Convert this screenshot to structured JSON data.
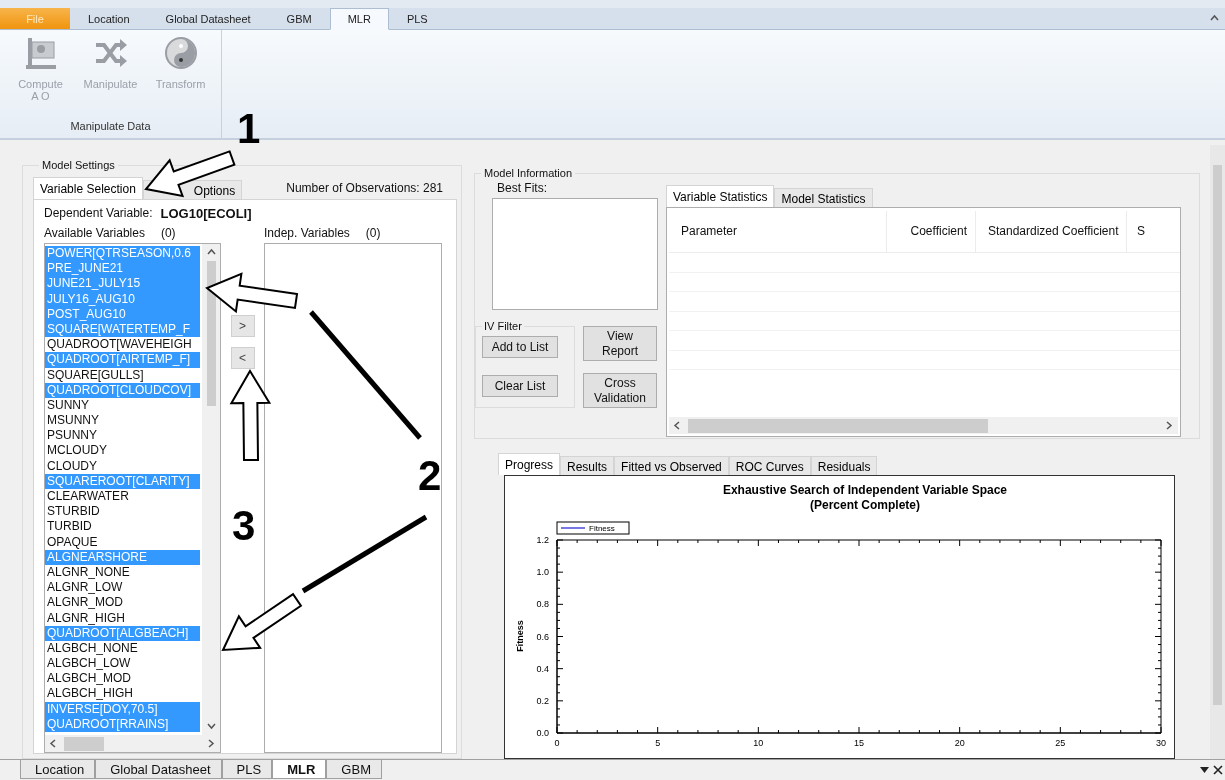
{
  "ribbon": {
    "file_tab": "File",
    "tabs": [
      {
        "label": "Location",
        "selected": false
      },
      {
        "label": "Global Datasheet",
        "selected": false
      },
      {
        "label": "GBM",
        "selected": false
      },
      {
        "label": "MLR",
        "selected": true
      },
      {
        "label": "PLS",
        "selected": false
      }
    ],
    "groups": [
      {
        "label": "Manipulate Data",
        "buttons": [
          {
            "label": "Compute\nA O",
            "kind": "flag",
            "disabled": true
          },
          {
            "label": "Manipulate",
            "kind": "shuffle",
            "disabled": true
          },
          {
            "label": "Transform",
            "kind": "yinyang",
            "disabled": true
          }
        ]
      }
    ]
  },
  "model_settings": {
    "title": "Model Settings",
    "tabs": [
      {
        "label": "Variable Selection",
        "selected": true
      },
      {
        "label": "Options",
        "selected": false
      }
    ],
    "observations": "Number of Observations: 281",
    "dependent_label": "Dependent Variable:",
    "dependent_value": "LOG10[ECOLI]",
    "available_label": "Available Variables",
    "available_count": "(0)",
    "indep_label": "Indep. Variables",
    "indep_count": "(0)",
    "move_buttons": [
      ">",
      "<"
    ],
    "available_variables": [
      {
        "name": "POWER[QTRSEASON,0.6",
        "selected": true
      },
      {
        "name": "PRE_JUNE21",
        "selected": true
      },
      {
        "name": "JUNE21_JULY15",
        "selected": true
      },
      {
        "name": "JULY16_AUG10",
        "selected": true
      },
      {
        "name": "POST_AUG10",
        "selected": true
      },
      {
        "name": "SQUARE[WATERTEMP_F",
        "selected": true
      },
      {
        "name": "QUADROOT[WAVEHEIGH",
        "selected": false
      },
      {
        "name": "QUADROOT[AIRTEMP_F]",
        "selected": true
      },
      {
        "name": "SQUARE[GULLS]",
        "selected": false
      },
      {
        "name": "QUADROOT[CLOUDCOV]",
        "selected": true
      },
      {
        "name": "SUNNY",
        "selected": false
      },
      {
        "name": "MSUNNY",
        "selected": false
      },
      {
        "name": "PSUNNY",
        "selected": false
      },
      {
        "name": "MCLOUDY",
        "selected": false
      },
      {
        "name": "CLOUDY",
        "selected": false
      },
      {
        "name": "SQUAREROOT[CLARITY]",
        "selected": true
      },
      {
        "name": "CLEARWATER",
        "selected": false
      },
      {
        "name": "STURBID",
        "selected": false
      },
      {
        "name": "TURBID",
        "selected": false
      },
      {
        "name": "OPAQUE",
        "selected": false
      },
      {
        "name": "ALGNEARSHORE",
        "selected": true
      },
      {
        "name": "ALGNR_NONE",
        "selected": false
      },
      {
        "name": "ALGNR_LOW",
        "selected": false
      },
      {
        "name": "ALGNR_MOD",
        "selected": false
      },
      {
        "name": "ALGNR_HIGH",
        "selected": false
      },
      {
        "name": "QUADROOT[ALGBEACH]",
        "selected": true
      },
      {
        "name": "ALGBCH_NONE",
        "selected": false
      },
      {
        "name": "ALGBCH_LOW",
        "selected": false
      },
      {
        "name": "ALGBCH_MOD",
        "selected": false
      },
      {
        "name": "ALGBCH_HIGH",
        "selected": false
      },
      {
        "name": "INVERSE[DOY,70.5]",
        "selected": true
      },
      {
        "name": "QUADROOT[RRAINS]",
        "selected": true
      }
    ]
  },
  "model_information": {
    "title": "Model Information",
    "best_fits_label": "Best Fits:",
    "iv_filter": {
      "title": "IV Filter",
      "buttons": [
        "Add to List",
        "Clear List"
      ]
    },
    "buttons": [
      "View\nReport",
      "Cross\nValidation"
    ],
    "stats_tabs": [
      {
        "label": "Variable Statistics",
        "selected": true
      },
      {
        "label": "Model Statistics",
        "selected": false
      }
    ],
    "table": {
      "columns": [
        "Parameter",
        "Coefficient",
        "Standardized Coefficient",
        "S"
      ]
    }
  },
  "result_tabs": [
    {
      "label": "Progress",
      "selected": true
    },
    {
      "label": "Results",
      "selected": false
    },
    {
      "label": "Fitted vs Observed",
      "selected": false
    },
    {
      "label": "ROC Curves",
      "selected": false
    },
    {
      "label": "Residuals",
      "selected": false
    }
  ],
  "progress_chart": {
    "chart_data": {
      "type": "line",
      "title": "Exhaustive Search of Independent Variable Space\n(Percent Complete)",
      "ylabel": "Fitness",
      "series": [
        {
          "name": "Fitness",
          "color": "#4a4adc",
          "values": [
            null,
            null,
            null,
            null,
            null,
            null,
            null
          ]
        }
      ],
      "categories": [
        "0",
        "5",
        "10",
        "15",
        "20",
        "25",
        "30"
      ],
      "ylim": [
        0,
        1.2
      ],
      "yticks": [
        {
          "value": 0,
          "label": "0.0"
        },
        {
          "value": 0.2,
          "label": "0.2"
        },
        {
          "value": 0.4,
          "label": "0.4"
        },
        {
          "value": 0.6,
          "label": "0.6"
        },
        {
          "value": 0.8,
          "label": "0.8"
        },
        {
          "value": 1,
          "label": "1.0"
        },
        {
          "value": 1.2,
          "label": "1.2"
        }
      ]
    }
  },
  "document_tabs": [
    {
      "label": "Location",
      "selected": false
    },
    {
      "label": "Global Datasheet",
      "selected": false
    },
    {
      "label": "PLS",
      "selected": false
    },
    {
      "label": "MLR",
      "selected": true
    },
    {
      "label": "GBM",
      "selected": false
    }
  ],
  "annotations": [
    {
      "label": "1"
    },
    {
      "label": "2"
    },
    {
      "label": "3"
    }
  ]
}
